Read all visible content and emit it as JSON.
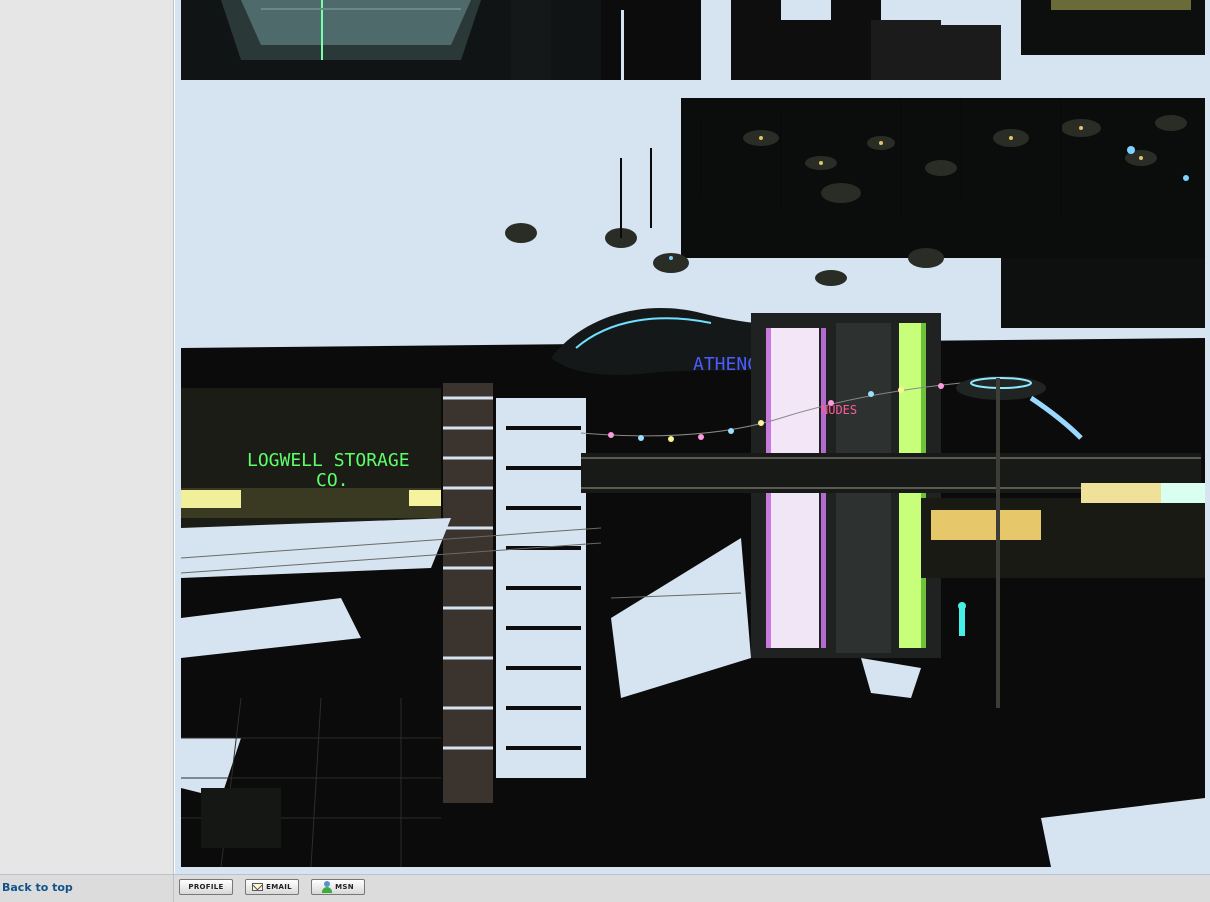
{
  "post": {
    "back_to_top": "Back to top",
    "buttons": {
      "profile": "PROFILE",
      "email": "EMAIL",
      "msn": "MSN"
    }
  },
  "screenshot": {
    "sign_storage_line1": "LOGWELL STORAGE",
    "sign_storage_line2": "CO.",
    "sign_neon": "ATHENCS"
  },
  "colors": {
    "page_bg": "#d6e4f2",
    "left_col_bg": "#e6e6e6",
    "link": "#105289",
    "neon_green": "#5cff6a",
    "neon_blue": "#3a5cff",
    "neon_pink": "#ff5a9a"
  },
  "icons": [
    "mail-icon",
    "msn-user-icon"
  ]
}
